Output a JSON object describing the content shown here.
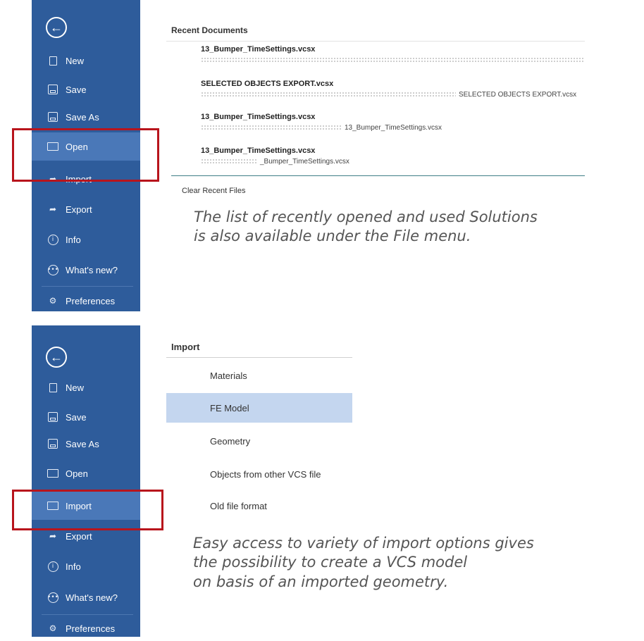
{
  "panel1": {
    "sidebar": {
      "back_icon": "back-arrow-icon",
      "items": [
        {
          "label": "New",
          "icon": "new-document-icon"
        },
        {
          "label": "Save",
          "icon": "save-icon"
        },
        {
          "label": "Save As",
          "icon": "save-as-icon"
        },
        {
          "label": "Open",
          "icon": "open-folder-icon",
          "active": true
        },
        {
          "label": "Import",
          "icon": "import-icon"
        },
        {
          "label": "Export",
          "icon": "export-icon"
        },
        {
          "label": "Info",
          "icon": "info-icon"
        },
        {
          "label": "What's new?",
          "icon": "whats-new-icon"
        },
        {
          "label": "Preferences",
          "icon": "preferences-icon"
        }
      ]
    },
    "heading": "Recent Documents",
    "recent": [
      {
        "name": "13_Bumper_TimeSettings.vcsx",
        "path": ""
      },
      {
        "name": "SELECTED OBJECTS EXPORT.vcsx",
        "path": "SELECTED OBJECTS EXPORT.vcsx"
      },
      {
        "name": "13_Bumper_TimeSettings.vcsx",
        "path": "13_Bumper_TimeSettings.vcsx"
      },
      {
        "name": "13_Bumper_TimeSettings.vcsx",
        "path": "_Bumper_TimeSettings.vcsx"
      }
    ],
    "clear_label": "Clear Recent Files",
    "caption": [
      "The list of recently opened and used Solutions",
      "is also available under the File menu."
    ]
  },
  "panel2": {
    "sidebar": {
      "back_icon": "back-arrow-icon",
      "items": [
        {
          "label": "New",
          "icon": "new-document-icon"
        },
        {
          "label": "Save",
          "icon": "save-icon"
        },
        {
          "label": "Save As",
          "icon": "save-as-icon"
        },
        {
          "label": "Open",
          "icon": "open-folder-icon"
        },
        {
          "label": "Import",
          "icon": "import-icon",
          "active": true
        },
        {
          "label": "Export",
          "icon": "export-icon"
        },
        {
          "label": "Info",
          "icon": "info-icon"
        },
        {
          "label": "What's new?",
          "icon": "whats-new-icon"
        },
        {
          "label": "Preferences",
          "icon": "preferences-icon"
        }
      ]
    },
    "heading": "Import",
    "options": [
      {
        "label": "Materials"
      },
      {
        "label": "FE Model",
        "selected": true
      },
      {
        "label": "Geometry"
      },
      {
        "label": "Objects from other VCS file"
      },
      {
        "label": "Old file format"
      }
    ],
    "caption": [
      "Easy access to variety of import options gives",
      "the possibility to create a VCS model",
      "on basis of an imported geometry."
    ]
  },
  "colors": {
    "sidebar": "#2e5c9b",
    "sidebar_active": "#4a78b8",
    "highlight_box": "#b8141c",
    "selected_option": "#c4d6ef"
  }
}
